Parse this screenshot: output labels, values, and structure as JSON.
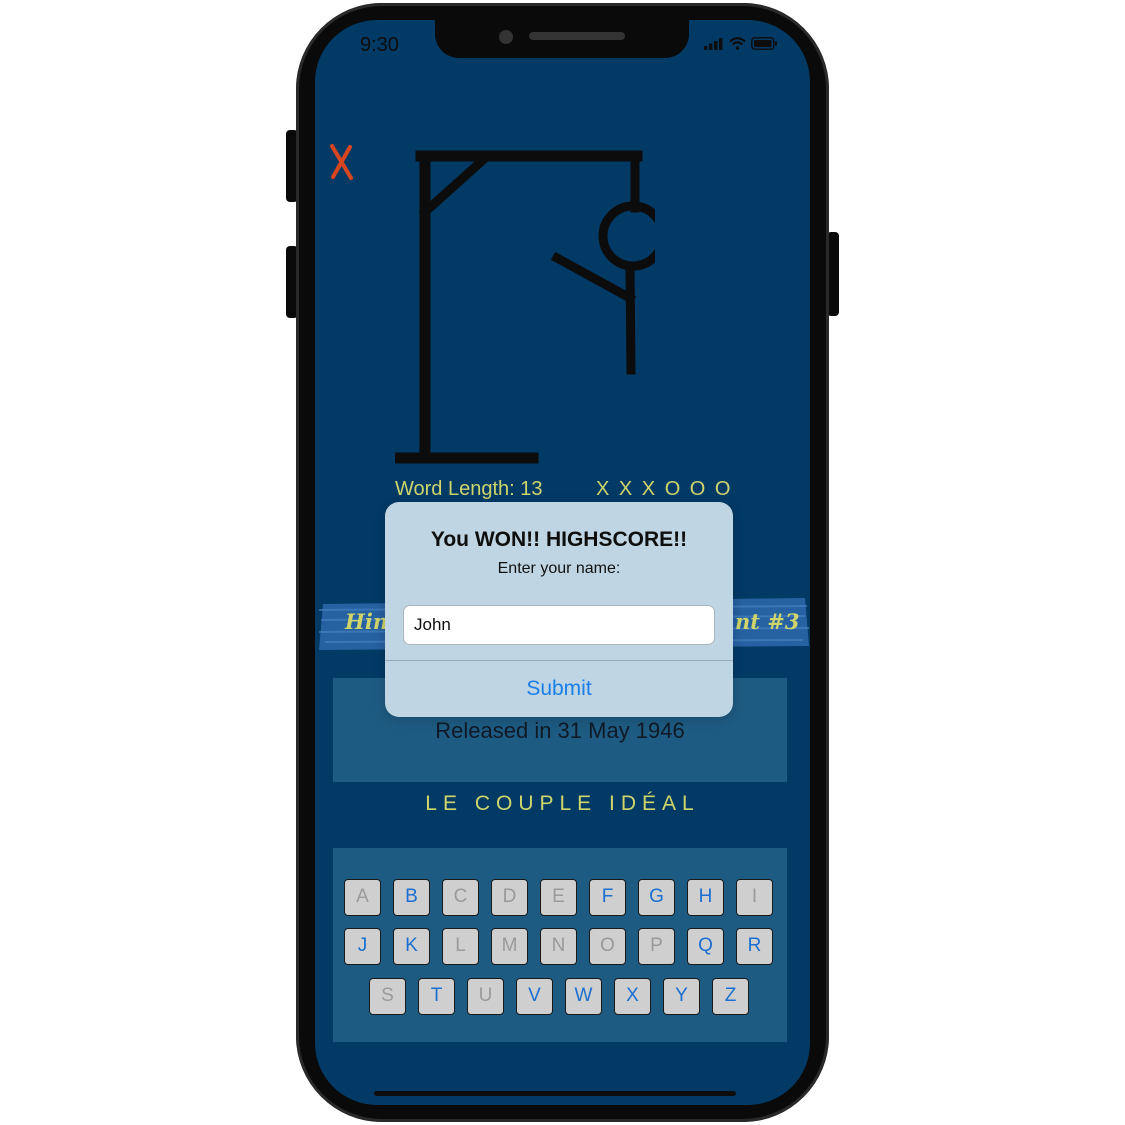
{
  "status_bar": {
    "time": "9:30"
  },
  "icons": {
    "close": "close-x-icon",
    "signal": "cellular-signal-icon",
    "wifi": "wifi-icon",
    "battery": "battery-icon"
  },
  "game": {
    "word_length": "Word Length: 13",
    "misses": "X X X O O O",
    "hint_left": "Hin",
    "hint_right": "nt #3",
    "hint_text": "Released in 31 May 1946",
    "answer": "LE COUPLE IDÉAL"
  },
  "keyboard": {
    "rows": [
      [
        {
          "l": "A",
          "s": "used"
        },
        {
          "l": "B",
          "s": "available"
        },
        {
          "l": "C",
          "s": "used"
        },
        {
          "l": "D",
          "s": "used"
        },
        {
          "l": "E",
          "s": "used"
        },
        {
          "l": "F",
          "s": "available"
        },
        {
          "l": "G",
          "s": "available"
        },
        {
          "l": "H",
          "s": "available"
        },
        {
          "l": "I",
          "s": "used"
        }
      ],
      [
        {
          "l": "J",
          "s": "available"
        },
        {
          "l": "K",
          "s": "available"
        },
        {
          "l": "L",
          "s": "used"
        },
        {
          "l": "M",
          "s": "used"
        },
        {
          "l": "N",
          "s": "used"
        },
        {
          "l": "O",
          "s": "used"
        },
        {
          "l": "P",
          "s": "used"
        },
        {
          "l": "Q",
          "s": "available"
        },
        {
          "l": "R",
          "s": "available"
        }
      ],
      [
        {
          "l": "S",
          "s": "used"
        },
        {
          "l": "T",
          "s": "available"
        },
        {
          "l": "U",
          "s": "used"
        },
        {
          "l": "V",
          "s": "available"
        },
        {
          "l": "W",
          "s": "available"
        },
        {
          "l": "X",
          "s": "available"
        },
        {
          "l": "Y",
          "s": "available"
        },
        {
          "l": "Z",
          "s": "available"
        }
      ]
    ]
  },
  "alert": {
    "title": "You WON!! HIGHSCORE!!",
    "message": "Enter your name:",
    "input_value": "John",
    "submit_label": "Submit"
  },
  "colors": {
    "background": "#023a66",
    "panel": "#1e5b82",
    "accent_text": "#cfd56b",
    "key_available": "#1a6fd0",
    "key_used": "#9a9a9a",
    "alert_bg": "#bfd5e3",
    "submit": "#1a7ee8",
    "close": "#d9451f"
  }
}
